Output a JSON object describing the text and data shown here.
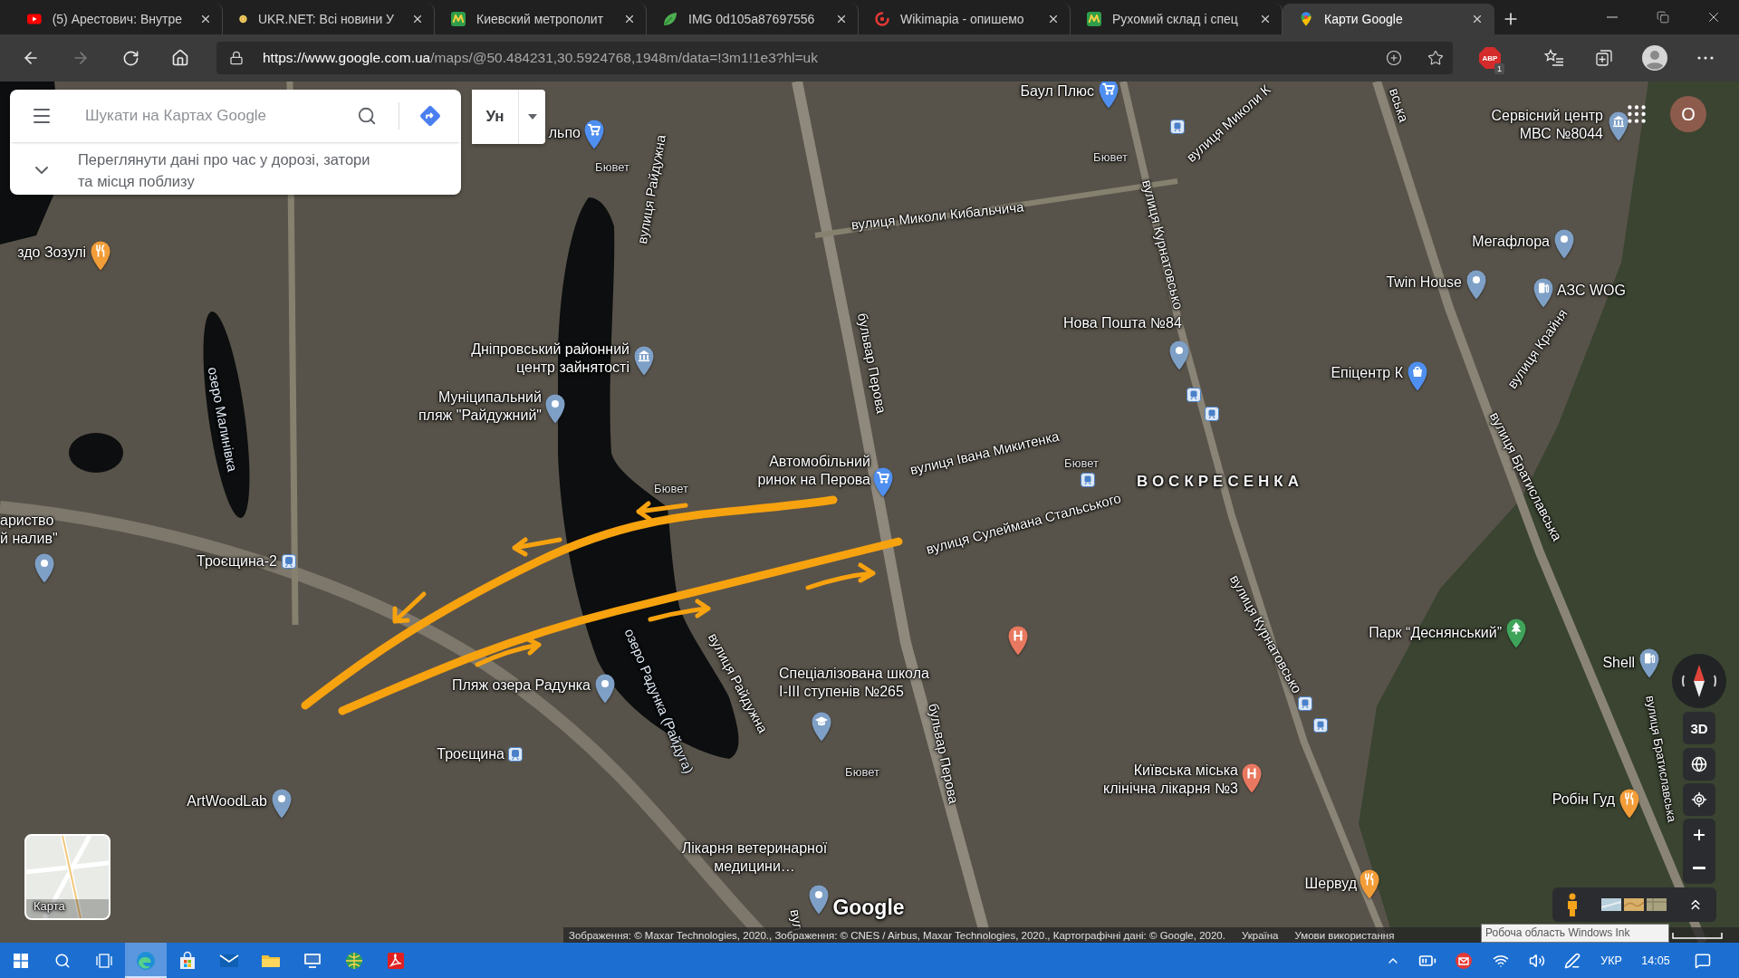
{
  "browser": {
    "tabs": [
      {
        "title": "(5) Арестович: Внутре",
        "kind": "video",
        "selected": false
      },
      {
        "title": "UKR.NET: Всі новини У",
        "kind": "news",
        "selected": false
      },
      {
        "title": "Киевский метрополит",
        "kind": "metro",
        "selected": false
      },
      {
        "title": "IMG 0d105a87697556",
        "kind": "leaf",
        "selected": false
      },
      {
        "title": "Wikimapia - опишемо",
        "kind": "wiki",
        "selected": false
      },
      {
        "title": "Рухомий склад і спец",
        "kind": "metro",
        "selected": false
      },
      {
        "title": "Карти Google",
        "kind": "maps",
        "selected": true
      }
    ],
    "nav": {
      "forward_disabled": true
    },
    "address": {
      "host": "https://www.google.com.ua",
      "path": "/maps/@50.484231,30.5924768,1948m/data=!3m1!1e3?hl=uk"
    },
    "extension": {
      "label": "ABP",
      "count": "1"
    }
  },
  "maps": {
    "search": {
      "placeholder": "Шукати на Картах Google",
      "hint_lines": [
        "Переглянути дані про час у дорозі, затори",
        "та місця поблизу"
      ]
    },
    "language_button": "Ун",
    "account_initial": "O",
    "streets": [
      "вулиця Райдужна",
      "вулиця Миколи К",
      "вулиця Миколи Кибальчича",
      "бульвар Перова",
      "вулиця Курнатовсько",
      "вулиця Крайня",
      "вська",
      "вулиця Івана Микитенка",
      "вулиця Сулеймана Стальського",
      "вулиця Братиславська",
      "вулиця Райдужна",
      "бульвар Перова",
      "вулиця Курнатовсько",
      "вулиця Братиславська",
      "вул"
    ],
    "water_labels": [
      "озеро Малинівка",
      "озеро Радунка (Райдуга)"
    ],
    "area_label": "ВОСКРЕСЕНКА",
    "places": [
      {
        "label": [
          "Баул Плюс"
        ],
        "kind": "shop",
        "color": "#4f8ff0"
      },
      {
        "label": [
          "льпо"
        ],
        "kind": "shop",
        "color": "#4f8ff0"
      },
      {
        "label": [
          "Сервісний центр",
          "МВС №8044"
        ],
        "kind": "government",
        "color": "#7fa0c6"
      },
      {
        "label": [
          "здо Зозулі"
        ],
        "kind": "food",
        "color": "#f29d38"
      },
      {
        "label": [
          "Мегафлора"
        ],
        "kind": "place",
        "color": "#7fa0c6"
      },
      {
        "label": [
          "Twin House"
        ],
        "kind": "place",
        "color": "#7fa0c6"
      },
      {
        "label": [
          "АЗС WOG"
        ],
        "kind": "fuel",
        "color": "#7fa0c6"
      },
      {
        "label": [
          "Нова Пошта №84"
        ],
        "kind": "place",
        "color": "#7fa0c6"
      },
      {
        "label": [
          "Дніпровський районний",
          "центр зайнятості"
        ],
        "kind": "government",
        "color": "#7fa0c6"
      },
      {
        "label": [
          "Епіцентр К"
        ],
        "kind": "bag",
        "color": "#4f8ff0"
      },
      {
        "label": [
          "Муніципальний",
          "пляж \"Райдужний\""
        ],
        "kind": "place",
        "color": "#7fa0c6"
      },
      {
        "label": [
          "Автомобільний",
          "ринок на Перова"
        ],
        "kind": "shop",
        "color": "#4f8ff0"
      },
      {
        "label": [
          "ариство",
          "й налив\""
        ],
        "kind": "place",
        "color": "#7fa0c6"
      },
      {
        "label": [
          "Пляж озера Радунка"
        ],
        "kind": "place",
        "color": "#7fa0c6"
      },
      {
        "label": [
          "Спеціалізована школа",
          "I-III ступенів №265"
        ],
        "kind": "school",
        "color": "#7fa0c6"
      },
      {
        "kind": "hospital",
        "color": "#e8785f"
      },
      {
        "label": [
          "Парк “Деснянський”"
        ],
        "kind": "park",
        "color": "#3fa45a"
      },
      {
        "label": [
          "Shell"
        ],
        "kind": "fuel",
        "color": "#7fa0c6"
      },
      {
        "label": [
          "ArtWoodLab"
        ],
        "kind": "place",
        "color": "#7fa0c6"
      },
      {
        "label": [
          "Київська міська",
          "клінічна лікарня №3"
        ],
        "kind": "hospital",
        "color": "#e8785f"
      },
      {
        "label": [
          "Робін Гуд"
        ],
        "kind": "food",
        "color": "#f29d38"
      },
      {
        "label": [
          "Лікарня ветеринарної",
          "медицини…"
        ],
        "kind": "place",
        "color": "#7fa0c6"
      },
      {
        "label": [
          "Шервуд"
        ],
        "kind": "food",
        "color": "#f29d38"
      }
    ],
    "stations": [
      "Троєщина-2",
      "Троєщина"
    ],
    "small_labels": [
      "Бювет",
      "Бювет",
      "Бювет",
      "Бювет",
      "Бювет"
    ],
    "tilt_button": "3D",
    "thumbnail_label": "Карта",
    "logo": "Google",
    "attribution": {
      "credits": "Зображення: © Maxar Technologies, 2020., Зображення: © CNES / Airbus, Maxar Technologies, 2020., Картографічні дані: © Google, 2020.",
      "region": "Україна",
      "terms": "Умови використання"
    }
  },
  "ink_tooltip": "Робоча область Windows Ink",
  "taskbar": {
    "apps": [
      {
        "kind": "browser",
        "active": true
      },
      {
        "kind": "store",
        "active": false
      },
      {
        "kind": "mail",
        "active": false
      },
      {
        "kind": "explorer",
        "active": false
      },
      {
        "kind": "network",
        "active": false
      },
      {
        "kind": "maps",
        "active": false
      },
      {
        "kind": "pdf",
        "active": false
      }
    ],
    "language": "УКР",
    "time": "14:05"
  }
}
